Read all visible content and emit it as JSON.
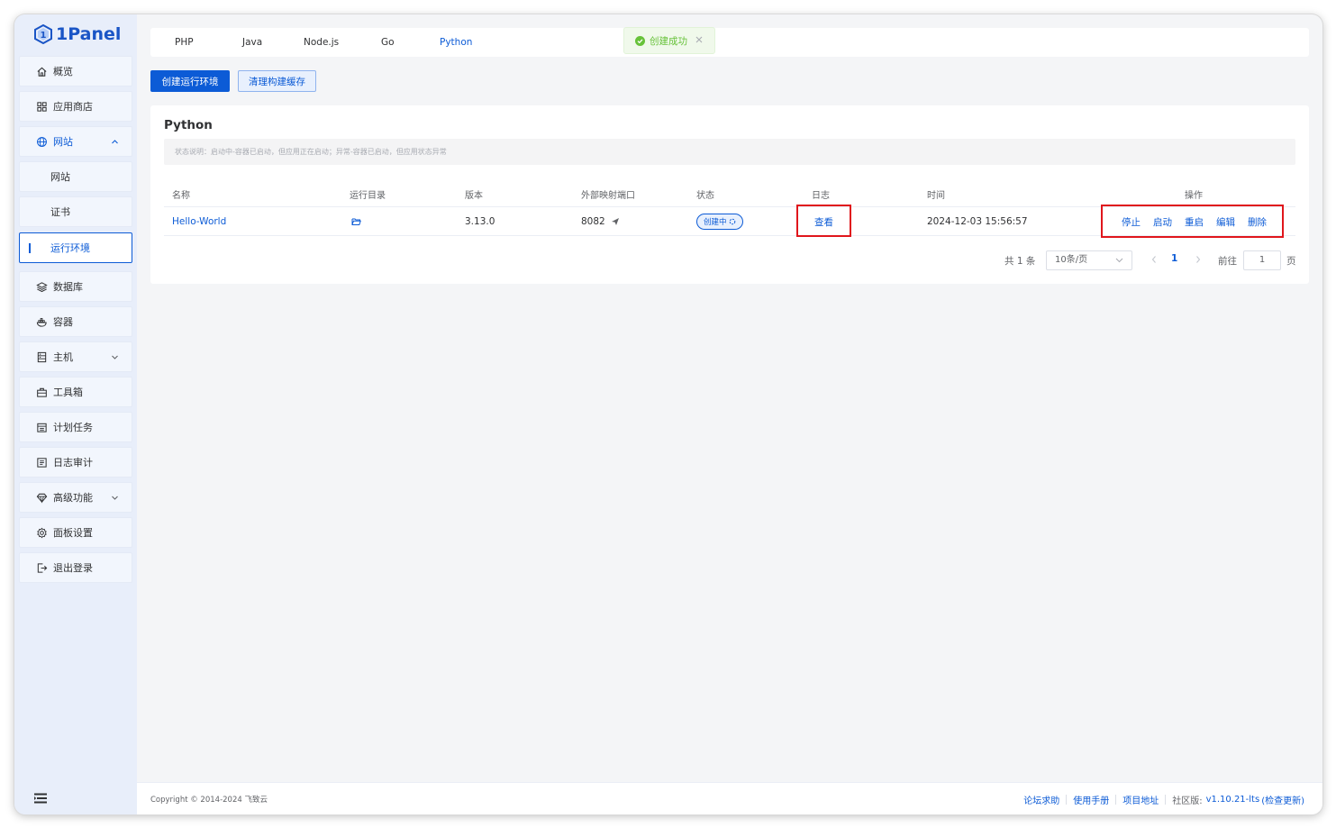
{
  "brand": {
    "name": "1Panel"
  },
  "sidebar": {
    "items": [
      {
        "label": "概览",
        "icon": "home-icon"
      },
      {
        "label": "应用商店",
        "icon": "grid-icon"
      },
      {
        "label": "网站",
        "icon": "globe-icon"
      },
      {
        "label": "网站"
      },
      {
        "label": "证书"
      },
      {
        "label": "运行环境"
      },
      {
        "label": "数据库",
        "icon": "layers-icon"
      },
      {
        "label": "容器",
        "icon": "docker-icon"
      },
      {
        "label": "主机",
        "icon": "server-icon"
      },
      {
        "label": "工具箱",
        "icon": "toolbox-icon"
      },
      {
        "label": "计划任务",
        "icon": "calendar-icon"
      },
      {
        "label": "日志审计",
        "icon": "log-icon"
      },
      {
        "label": "高级功能",
        "icon": "diamond-icon"
      },
      {
        "label": "面板设置",
        "icon": "gear-icon"
      },
      {
        "label": "退出登录",
        "icon": "logout-icon"
      }
    ]
  },
  "tabs": [
    "PHP",
    "Java",
    "Node.js",
    "Go",
    "Python"
  ],
  "active_tab": "Python",
  "toast": {
    "text": "创建成功"
  },
  "toolbar": {
    "create_label": "创建运行环境",
    "clear_label": "清理构建缓存"
  },
  "card": {
    "title": "Python",
    "notice": "状态说明：启动中-容器已启动，但应用正在启动；异常-容器已启动，但应用状态异常"
  },
  "table": {
    "headers": [
      "名称",
      "运行目录",
      "版本",
      "外部映射端口",
      "状态",
      "日志",
      "时间",
      "操作"
    ],
    "rows": [
      {
        "name": "Hello-World",
        "version": "3.13.0",
        "port": "8082",
        "status": "创建中",
        "log_action": "查看",
        "time": "2024-12-03 15:56:57",
        "actions": [
          "停止",
          "启动",
          "重启",
          "编辑",
          "删除"
        ]
      }
    ]
  },
  "pagination": {
    "total_text": "共 1 条",
    "page_size": "10条/页",
    "current_page": "1",
    "goto_label": "前往",
    "goto_value": "1",
    "page_suffix": "页"
  },
  "footer": {
    "copyright": "Copyright © 2014-2024 飞致云",
    "links": [
      "论坛求助",
      "使用手册",
      "项目地址"
    ],
    "edition_label": "社区版:",
    "version": "v1.10.21-lts",
    "check_update": "(检查更新)"
  },
  "colors": {
    "primary": "#0c5bd6",
    "success": "#67c23a",
    "highlight": "#e0161c",
    "sidebar_bg": "#e8eefa"
  }
}
